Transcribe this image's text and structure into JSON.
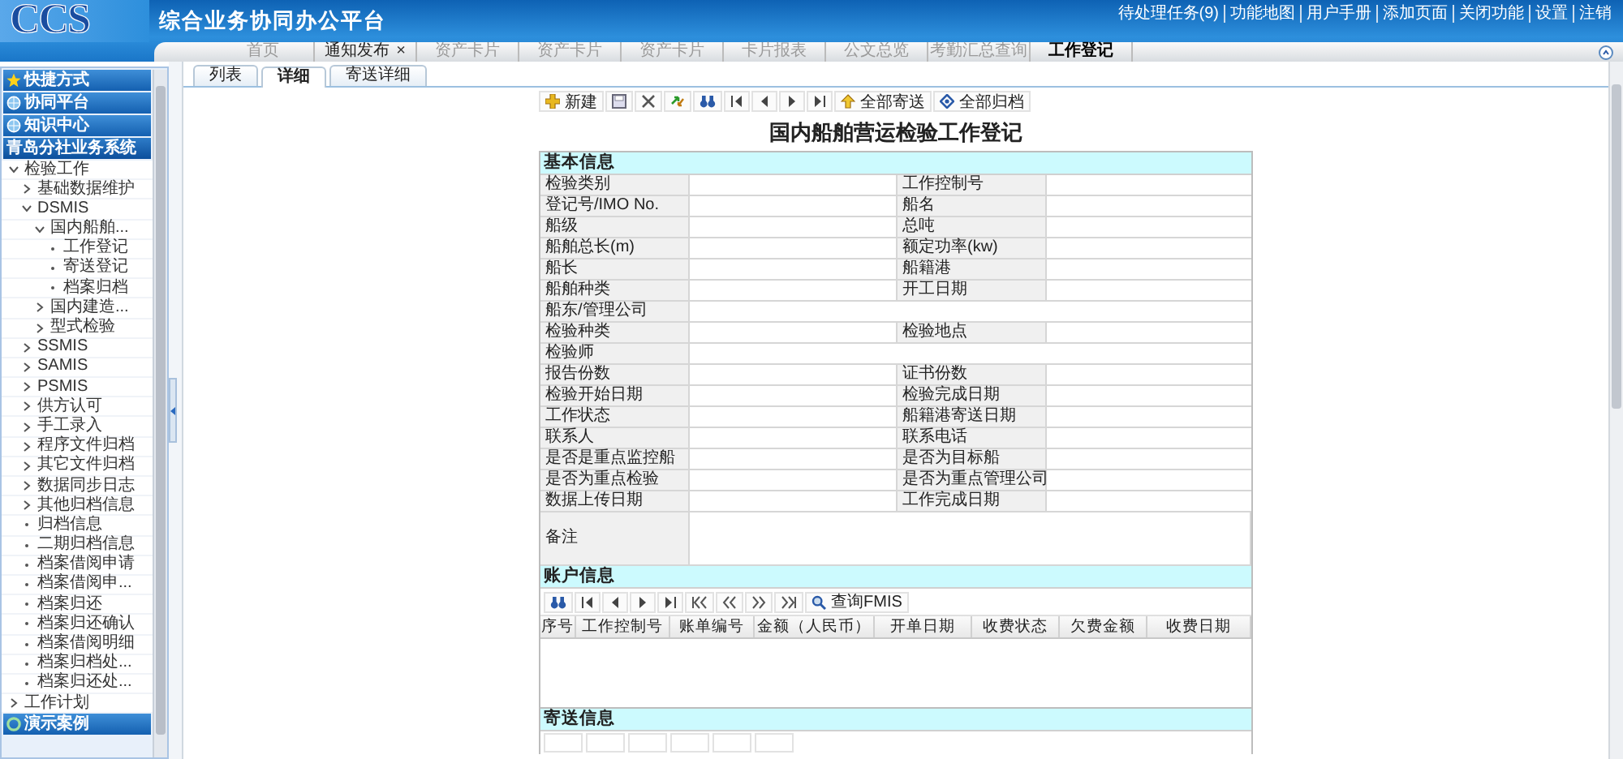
{
  "header": {
    "logo": "CCS",
    "title": "综合业务协同办公平台",
    "links": [
      "待处理任务(9)",
      "功能地图",
      "用户手册",
      "添加页面",
      "关闭功能",
      "设置",
      "注销"
    ]
  },
  "tabs": [
    {
      "label": "首页",
      "selected": false,
      "dimmed": true
    },
    {
      "label": "通知发布",
      "selected": false,
      "dimmed": false,
      "close": "×"
    },
    {
      "label": "资产卡片",
      "selected": false,
      "dimmed": true
    },
    {
      "label": "资产卡片",
      "selected": false,
      "dimmed": true
    },
    {
      "label": "资产卡片",
      "selected": false,
      "dimmed": true
    },
    {
      "label": "卡片报表",
      "selected": false,
      "dimmed": true
    },
    {
      "label": "公文总览",
      "selected": false,
      "dimmed": true
    },
    {
      "label": "考勤汇总查询",
      "selected": false,
      "dimmed": true
    },
    {
      "label": "工作登记",
      "selected": true,
      "dimmed": false
    }
  ],
  "sub_tabs": [
    {
      "label": "列表",
      "selected": false
    },
    {
      "label": "详细",
      "selected": true
    },
    {
      "label": "寄送详细",
      "selected": false
    }
  ],
  "sidebar": {
    "sections": [
      {
        "label": "快捷方式",
        "kind": "shortcut",
        "expanded": false
      },
      {
        "label": "协同平台",
        "kind": "module",
        "expanded": false
      },
      {
        "label": "知识中心",
        "kind": "module",
        "expanded": false
      },
      {
        "label": "青岛分社业务系统",
        "kind": "system",
        "expanded": true,
        "children": [
          {
            "label": "检验工作",
            "kind": "folder",
            "expanded": true,
            "children": [
              {
                "label": "基础数据维护",
                "kind": "folder",
                "expanded": false
              },
              {
                "label": "DSMIS",
                "kind": "folder",
                "expanded": true,
                "children": [
                  {
                    "label": "国内船舶...",
                    "kind": "folder",
                    "expanded": true,
                    "children": [
                      {
                        "label": "工作登记",
                        "kind": "leaf",
                        "expanded": false
                      },
                      {
                        "label": "寄送登记",
                        "kind": "leaf",
                        "expanded": false
                      },
                      {
                        "label": "档案归档",
                        "kind": "leaf",
                        "expanded": false
                      }
                    ]
                  },
                  {
                    "label": "国内建造...",
                    "kind": "folder",
                    "expanded": false
                  },
                  {
                    "label": "型式检验",
                    "kind": "folder",
                    "expanded": false
                  }
                ]
              },
              {
                "label": "SSMIS",
                "kind": "folder",
                "expanded": false
              },
              {
                "label": "SAMIS",
                "kind": "folder",
                "expanded": false
              },
              {
                "label": "PSMIS",
                "kind": "folder",
                "expanded": false
              },
              {
                "label": "供方认可",
                "kind": "folder",
                "expanded": false
              },
              {
                "label": "手工录入",
                "kind": "folder",
                "expanded": false
              },
              {
                "label": "程序文件归档",
                "kind": "folder",
                "expanded": false
              },
              {
                "label": "其它文件归档",
                "kind": "folder",
                "expanded": false
              },
              {
                "label": "数据同步日志",
                "kind": "folder",
                "expanded": false
              },
              {
                "label": "其他归档信息",
                "kind": "folder",
                "expanded": false
              },
              {
                "label": "归档信息",
                "kind": "leaf",
                "expanded": false
              },
              {
                "label": "二期归档信息",
                "kind": "leaf",
                "expanded": false
              },
              {
                "label": "档案借阅申请",
                "kind": "leaf",
                "expanded": false
              },
              {
                "label": "档案借阅申...",
                "kind": "leaf",
                "expanded": false
              },
              {
                "label": "档案归还",
                "kind": "leaf",
                "expanded": false
              },
              {
                "label": "档案归还确认",
                "kind": "leaf",
                "expanded": false
              },
              {
                "label": "档案借阅明细",
                "kind": "leaf",
                "expanded": false
              },
              {
                "label": "档案归档处...",
                "kind": "leaf",
                "expanded": false
              },
              {
                "label": "档案归还处...",
                "kind": "leaf",
                "expanded": false
              }
            ]
          },
          {
            "label": "工作计划",
            "kind": "folder",
            "expanded": false
          }
        ]
      },
      {
        "label": "演示案例",
        "kind": "demo",
        "expanded": false
      }
    ]
  },
  "toolbar": [
    {
      "kind": "add",
      "label": "新建"
    },
    {
      "kind": "save"
    },
    {
      "kind": "delete"
    },
    {
      "kind": "refresh"
    },
    {
      "kind": "find"
    },
    {
      "kind": "first"
    },
    {
      "kind": "prev"
    },
    {
      "kind": "next"
    },
    {
      "kind": "last"
    },
    {
      "kind": "send",
      "label": "全部寄送"
    },
    {
      "kind": "archive",
      "label": "全部归档"
    }
  ],
  "form": {
    "title": "国内船舶营运检验工作登记",
    "basic_info": {
      "heading": "基本信息",
      "rows": [
        [
          "检验类别",
          "工作控制号"
        ],
        [
          "登记号/IMO No.",
          "船名"
        ],
        [
          "船级",
          "总吨"
        ],
        [
          "船舶总长(m)",
          "额定功率(kw)"
        ],
        [
          "船长",
          "船籍港"
        ],
        [
          "船舶种类",
          "开工日期"
        ],
        [
          "船东/管理公司"
        ],
        [
          "检验种类",
          "检验地点"
        ],
        [
          "检验师"
        ],
        [
          "报告份数",
          "证书份数"
        ],
        [
          "检验开始日期",
          "检验完成日期"
        ],
        [
          "工作状态",
          "船籍港寄送日期"
        ],
        [
          "联系人",
          "联系电话"
        ],
        [
          "是否是重点监控船",
          "是否为目标船"
        ],
        [
          "是否为重点检验",
          "是否为重点管理公司"
        ],
        [
          "数据上传日期",
          "工作完成日期"
        ]
      ],
      "remarks_label": "备注"
    },
    "account_info": {
      "heading": "账户信息",
      "toolbar": [
        {
          "kind": "find"
        },
        {
          "kind": "first"
        },
        {
          "kind": "prev"
        },
        {
          "kind": "next"
        },
        {
          "kind": "last"
        },
        {
          "kind": "fast-first"
        },
        {
          "kind": "fast-prev"
        },
        {
          "kind": "fast-next"
        },
        {
          "kind": "fast-last"
        },
        {
          "kind": "search",
          "label": "查询FMIS"
        }
      ],
      "columns": [
        "序号",
        "工作控制号",
        "账单编号",
        "金额（人民币）",
        "开单日期",
        "收费状态",
        "欠费金额",
        "收费日期"
      ]
    },
    "send_info": {
      "heading": "寄送信息"
    }
  }
}
